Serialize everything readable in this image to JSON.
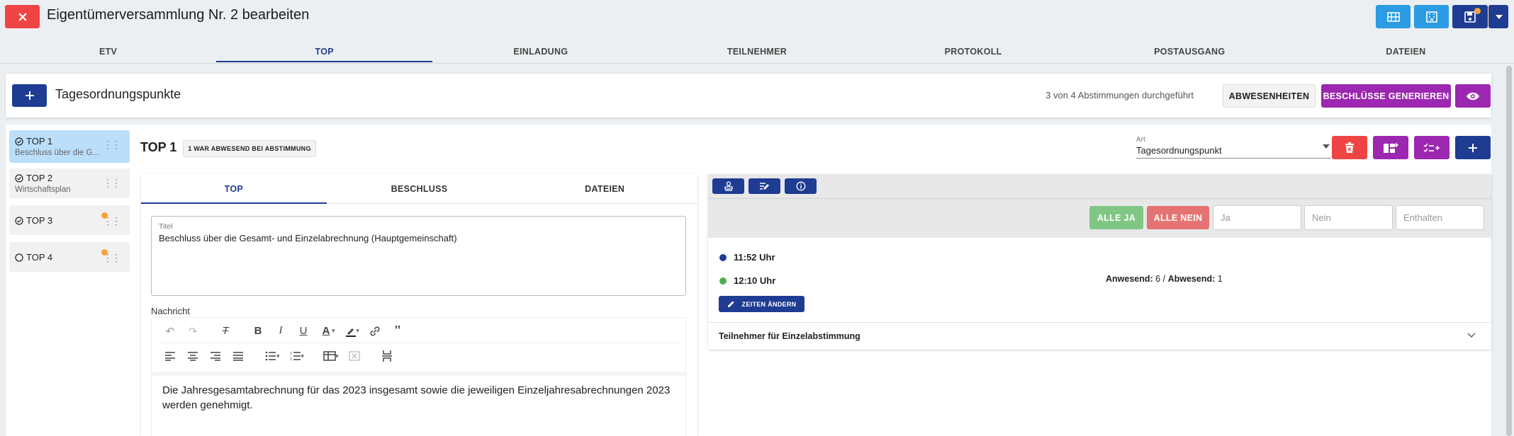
{
  "header": {
    "title": "Eigentümerversammlung Nr. 2 bearbeiten",
    "buttons": [
      "map-icon",
      "building-icon",
      "save-icon",
      "chevron-down-icon"
    ]
  },
  "tabs": [
    {
      "label": "ETV",
      "active": false
    },
    {
      "label": "TOP",
      "active": true
    },
    {
      "label": "EINLADUNG",
      "active": false
    },
    {
      "label": "TEILNEHMER",
      "active": false
    },
    {
      "label": "PROTOKOLL",
      "active": false
    },
    {
      "label": "POSTAUSGANG",
      "active": false
    },
    {
      "label": "DATEIEN",
      "active": false
    }
  ],
  "toolbar": {
    "title": "Tagesordnungspunkte",
    "vote_status": "3 von 4 Abstimmungen durchgeführt",
    "absences_label": "ABWESENHEITEN",
    "generate_label": "BESCHLÜSSE GENERIEREN"
  },
  "sidebar": {
    "items": [
      {
        "label": "TOP 1",
        "sub": "Beschluss über die G...",
        "icon": "check-circle-icon",
        "active": true,
        "dot": false
      },
      {
        "label": "TOP 2",
        "sub": "Wirtschaftsplan",
        "icon": "check-circle-icon",
        "active": false,
        "dot": false
      },
      {
        "label": "TOP 3",
        "sub": "",
        "icon": "check-circle-icon",
        "active": false,
        "dot": true
      },
      {
        "label": "TOP 4",
        "sub": "",
        "icon": "circle-icon",
        "active": false,
        "dot": true
      }
    ]
  },
  "detail": {
    "heading": "TOP 1",
    "absent_chip": "1 WAR ABWESEND BEI ABSTIMMUNG",
    "art_label": "Art",
    "art_value": "Tagesordnungspunkt"
  },
  "left_card": {
    "tabs": [
      "TOP",
      "BESCHLUSS",
      "DATEIEN"
    ],
    "title_label": "Titel",
    "title_value": "Beschluss über die Gesamt- und Einzelabrechnung (Hauptgemeinschaft)",
    "message_label": "Nachricht",
    "message_text": "Die Jahresgesamtabrechnung für das 2023 insgesamt sowie die jeweiligen Einzeljahresabrechnungen 2023 werden genehmigt."
  },
  "voting": {
    "all_yes": "ALLE JA",
    "all_no": "ALLE NEIN",
    "placeholders": {
      "yes": "Ja",
      "no": "Nein",
      "abstain": "Enthalten"
    },
    "times": [
      {
        "label": "11:52 Uhr",
        "color": "#1f3c93"
      },
      {
        "label": "12:10 Uhr",
        "color": "#4caf50"
      }
    ],
    "change_times_label": "ZEITEN ÄNDERN",
    "present_label": "Anwesend:",
    "present_value": "6",
    "separator": "/",
    "absent_label": "Abwesend:",
    "absent_value": "1",
    "single_vote_label": "Teilnehmer für Einzelabstimmung"
  },
  "colors": {
    "navy": "#1f3c93",
    "light_blue": "#2b9be3",
    "purple": "#9c27b0",
    "red": "#ef4444",
    "orange_dot": "#f7a23b"
  }
}
